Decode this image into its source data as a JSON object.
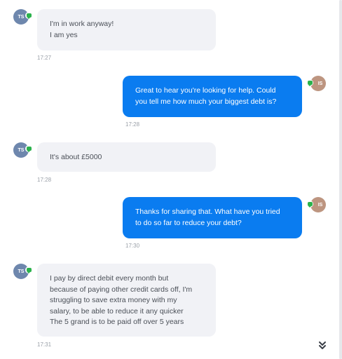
{
  "messages": [
    {
      "direction": "in",
      "avatar": "TS",
      "lines": [
        "I'm in work anyway!",
        "I am yes"
      ],
      "time": "17:27"
    },
    {
      "direction": "out",
      "avatar": "IS",
      "lines": [
        "Great to hear you're looking for help. Could",
        "you tell me how much your biggest debt is?"
      ],
      "time": "17:28"
    },
    {
      "direction": "in",
      "avatar": "TS",
      "lines": [
        "It's about £5000"
      ],
      "time": "17:28"
    },
    {
      "direction": "out",
      "avatar": "IS",
      "lines": [
        "Thanks for sharing that. What have you tried",
        "to do so far to reduce your debt?"
      ],
      "time": "17:30"
    },
    {
      "direction": "in",
      "avatar": "TS",
      "lines": [
        "I pay by direct debit every month but",
        "because of paying other credit cards off, I'm",
        "struggling to save extra money with my",
        "salary, to be able to reduce it any quicker",
        "The 5 grand is to be paid off over 5 years"
      ],
      "time": "17:31"
    }
  ],
  "colors": {
    "incoming_bubble": "#f1f2f6",
    "outgoing_bubble": "#0a7cf0",
    "ts_avatar": "#6e87ad",
    "is_avatar": "#bd9580",
    "channel_badge": "#2bb24c"
  },
  "icons": {
    "channel": "sms-chat-icon",
    "scroll": "double-chevron-down-icon"
  }
}
